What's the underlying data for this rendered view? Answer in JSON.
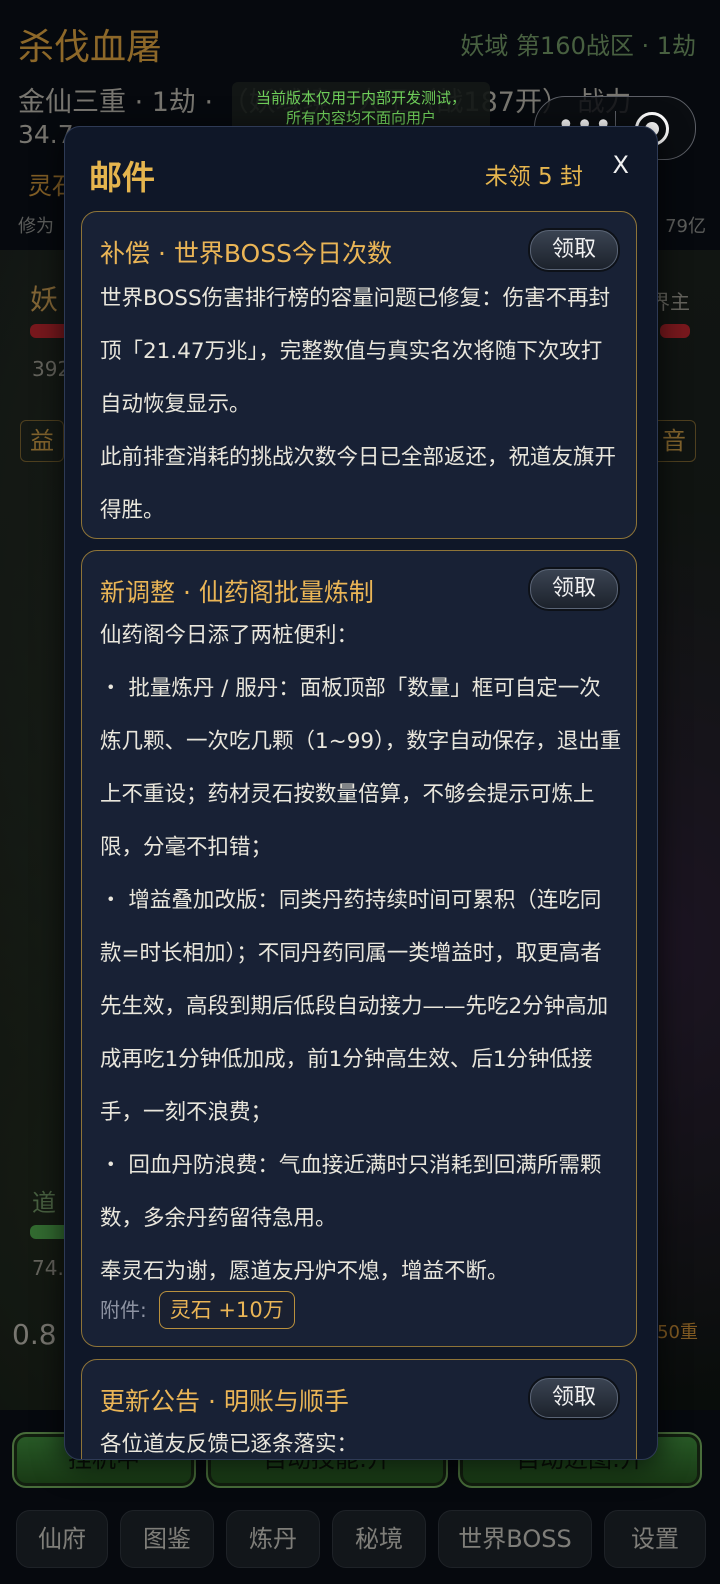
{
  "background": {
    "title": "杀伐血屠",
    "zone": "妖域 第160战区 · 1劫",
    "realm_line": "金仙三重 · 1劫 · （妖域境 · 大王（战187开） 战力",
    "power_cont": "34.7",
    "lingshi_label": "灵石",
    "xiuwei_label": "修为",
    "xiuwei_right": "79亿",
    "enemy_left": "妖",
    "enemy_right": "界主",
    "num_left": "392",
    "tag_left": "益",
    "tag_right": "音",
    "dao_label": "道",
    "num_74": "74.",
    "num_08": "0.8",
    "stack_50": "50重",
    "actions": [
      "挂机中",
      "自动技能:开",
      "自动进图:开"
    ],
    "nav": [
      "仙府",
      "图鉴",
      "炼丹",
      "秘境",
      "世界BOSS",
      "设置"
    ]
  },
  "dev_notice": {
    "line1": "当前版本仅用于内部开发测试，",
    "line2": "所有内容均不面向用户"
  },
  "mail": {
    "title": "邮件",
    "unread": "未领 5 封",
    "close": "X",
    "cards": [
      {
        "title": "补偿 · 世界BOSS今日次数",
        "claim": "领取",
        "paragraphs": [
          "世界BOSS伤害排行榜的容量问题已修复：伤害不再封顶「21.47万兆」，完整数值与真实名次将随下次攻打自动恢复显示。",
          "此前排查消耗的挑战次数今日已全部返还，祝道友旗开得胜。"
        ]
      },
      {
        "title": "新调整 · 仙药阁批量炼制",
        "claim": "领取",
        "paragraphs": [
          "仙药阁今日添了两桩便利：",
          "・ 批量炼丹 / 服丹：面板顶部「数量」框可自定一次炼几颗、一次吃几颗（1~99），数字自动保存，退出重上不重设；药材灵石按数量倍算，不够会提示可炼上限，分毫不扣错；",
          "・ 增益叠加改版：同类丹药持续时间可累积（连吃同款=时长相加）；不同丹药同属一类增益时，取更高者先生效，高段到期后低段自动接力——先吃2分钟高加成再吃1分钟低加成，前1分钟高生效、后1分钟低接手，一刻不浪费；",
          "・ 回血丹防浪费：气血接近满时只消耗到回满所需颗数，多余丹药留待急用。",
          "奉灵石为谢，愿道友丹炉不熄，增益不断。"
        ],
        "attachment_label": "附件:",
        "attachment": "灵石 +10万"
      },
      {
        "title": "更新公告 · 明账与顺手",
        "claim": "领取",
        "paragraphs": [
          "各位道友反馈已逐条落实："
        ]
      }
    ]
  }
}
